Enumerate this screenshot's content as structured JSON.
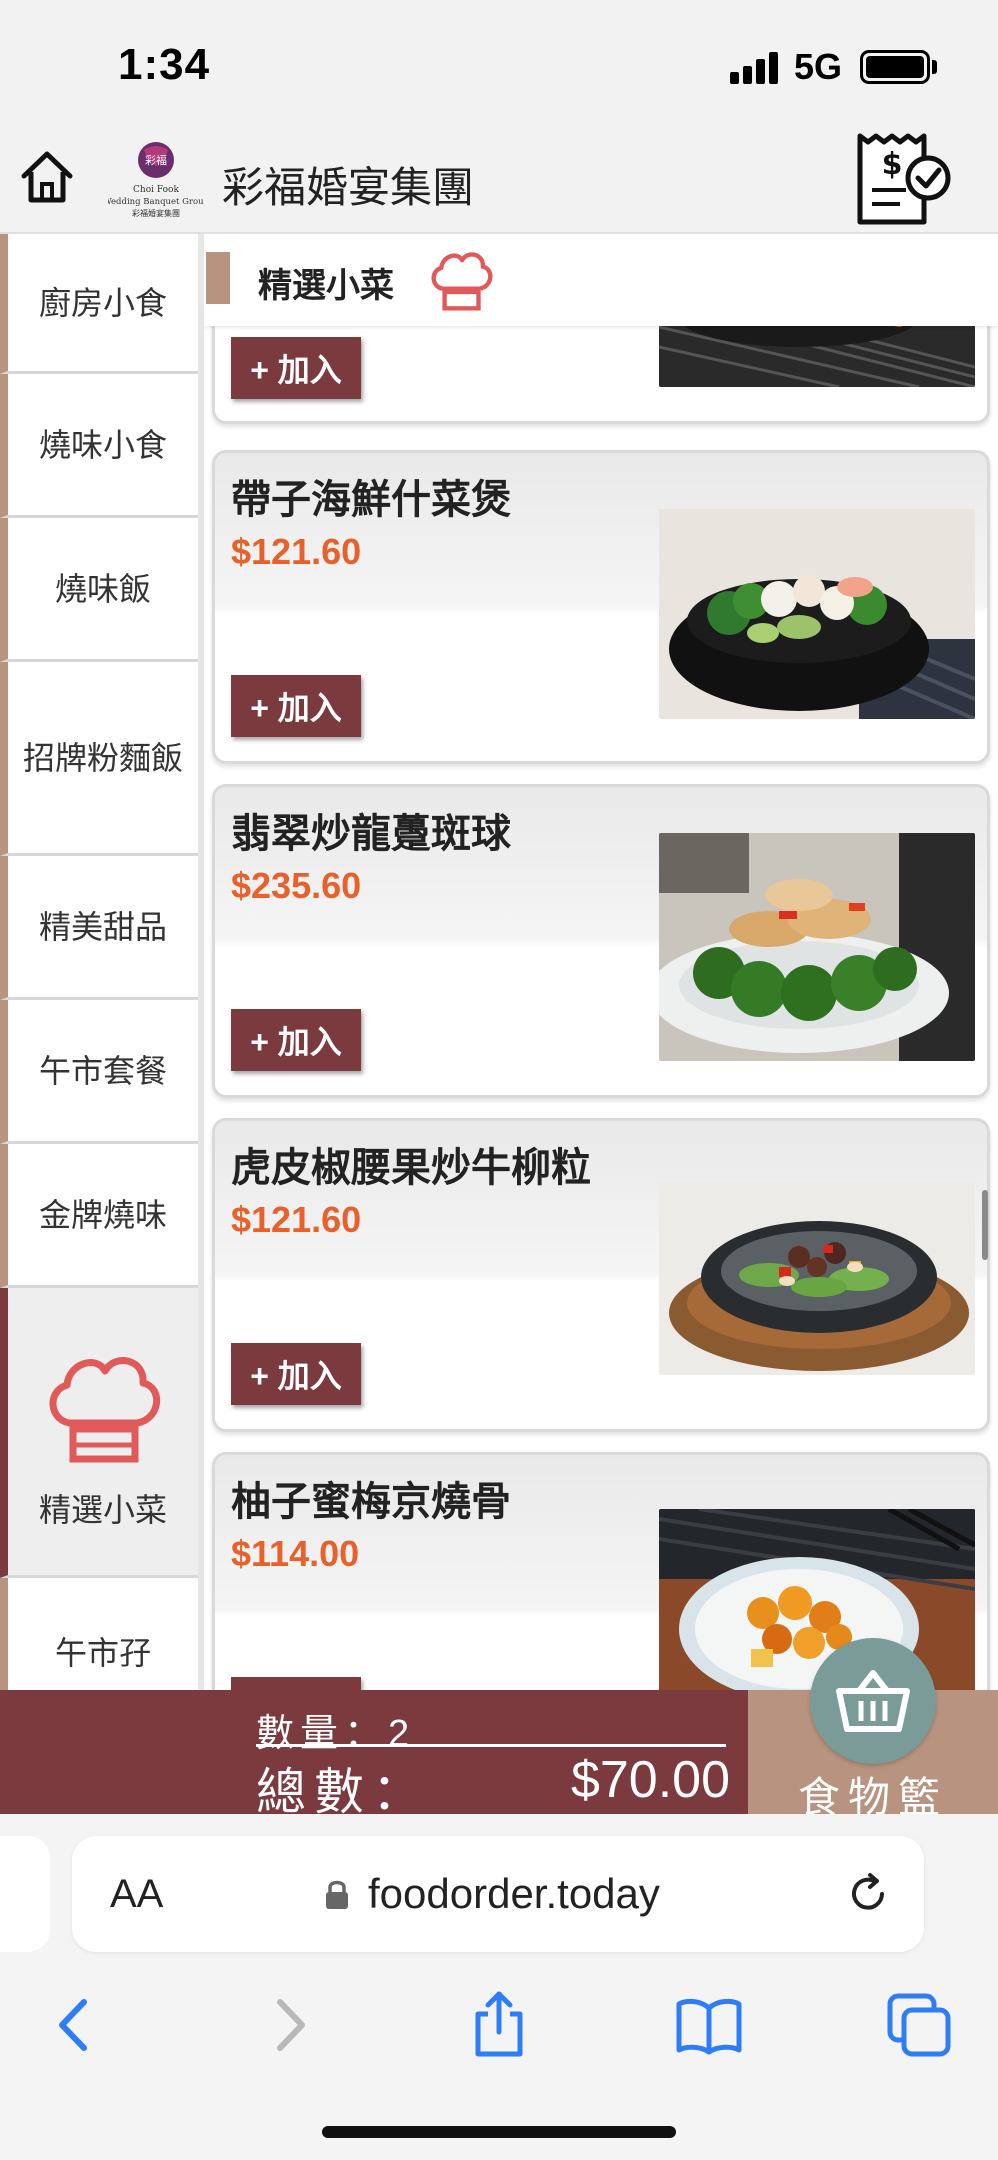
{
  "status_bar": {
    "time": "1:34",
    "network": "5G"
  },
  "header": {
    "brand_name": "彩福婚宴集團",
    "logo_text": "Choi Fook Wedding Banquet Group"
  },
  "sidebar": {
    "items": [
      {
        "label": "廚房小食"
      },
      {
        "label": "燒味小食"
      },
      {
        "label": "燒味飯"
      },
      {
        "label": "招牌粉麵飯"
      },
      {
        "label": "精美甜品"
      },
      {
        "label": "午市套餐"
      },
      {
        "label": "金牌燒味"
      },
      {
        "label": "精選小菜",
        "active": true
      },
      {
        "label": "午市孖"
      }
    ]
  },
  "section": {
    "title": "精選小菜"
  },
  "menu": {
    "add_label": "+ 加入",
    "items": [
      {
        "name": "帶子海鮮什菜煲",
        "price": "$121.60"
      },
      {
        "name": "翡翠炒龍躉斑球",
        "price": "$235.60"
      },
      {
        "name": "虎皮椒腰果炒牛柳粒",
        "price": "$121.60"
      },
      {
        "name": "柚子蜜梅京燒骨",
        "price": "$114.00"
      }
    ]
  },
  "cart": {
    "qty_label": "數量：",
    "qty_value": "2",
    "total_label": "總數：",
    "total_value": "$70.00",
    "basket_label": "食物籃"
  },
  "browser": {
    "aa": "AA",
    "url": "foodorder.today"
  },
  "colors": {
    "brand": "#7a3a3e",
    "accent": "#b89380",
    "price": "#e8602a",
    "chef_icon": "#e05a5a",
    "basket_circle": "#7b9b98",
    "ios_blue": "#2f7df6"
  }
}
